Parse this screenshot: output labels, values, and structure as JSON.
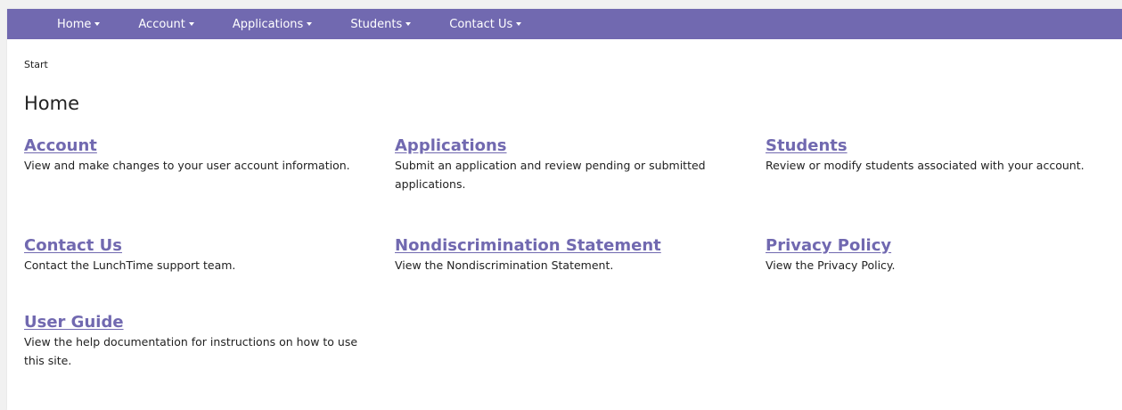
{
  "nav": {
    "items": [
      {
        "label": "Home"
      },
      {
        "label": "Account"
      },
      {
        "label": "Applications"
      },
      {
        "label": "Students"
      },
      {
        "label": "Contact Us"
      }
    ]
  },
  "breadcrumb": "Start",
  "page_title": "Home",
  "cards": [
    {
      "title": "Account",
      "description": "View and make changes to your user account information."
    },
    {
      "title": "Applications",
      "description": "Submit an application and review pending or submitted applications."
    },
    {
      "title": "Students",
      "description": "Review or modify students associated with your account."
    },
    {
      "title": "Contact Us",
      "description": "Contact the LunchTime support team."
    },
    {
      "title": "Nondiscrimination Statement",
      "description": "View the Nondiscrimination Statement."
    },
    {
      "title": "Privacy Policy",
      "description": "View the Privacy Policy."
    },
    {
      "title": "User Guide",
      "description": "View the help documentation for instructions on how to use this site."
    }
  ],
  "colors": {
    "brand": "#7169b0",
    "text": "#222222",
    "background": "#ffffff"
  }
}
